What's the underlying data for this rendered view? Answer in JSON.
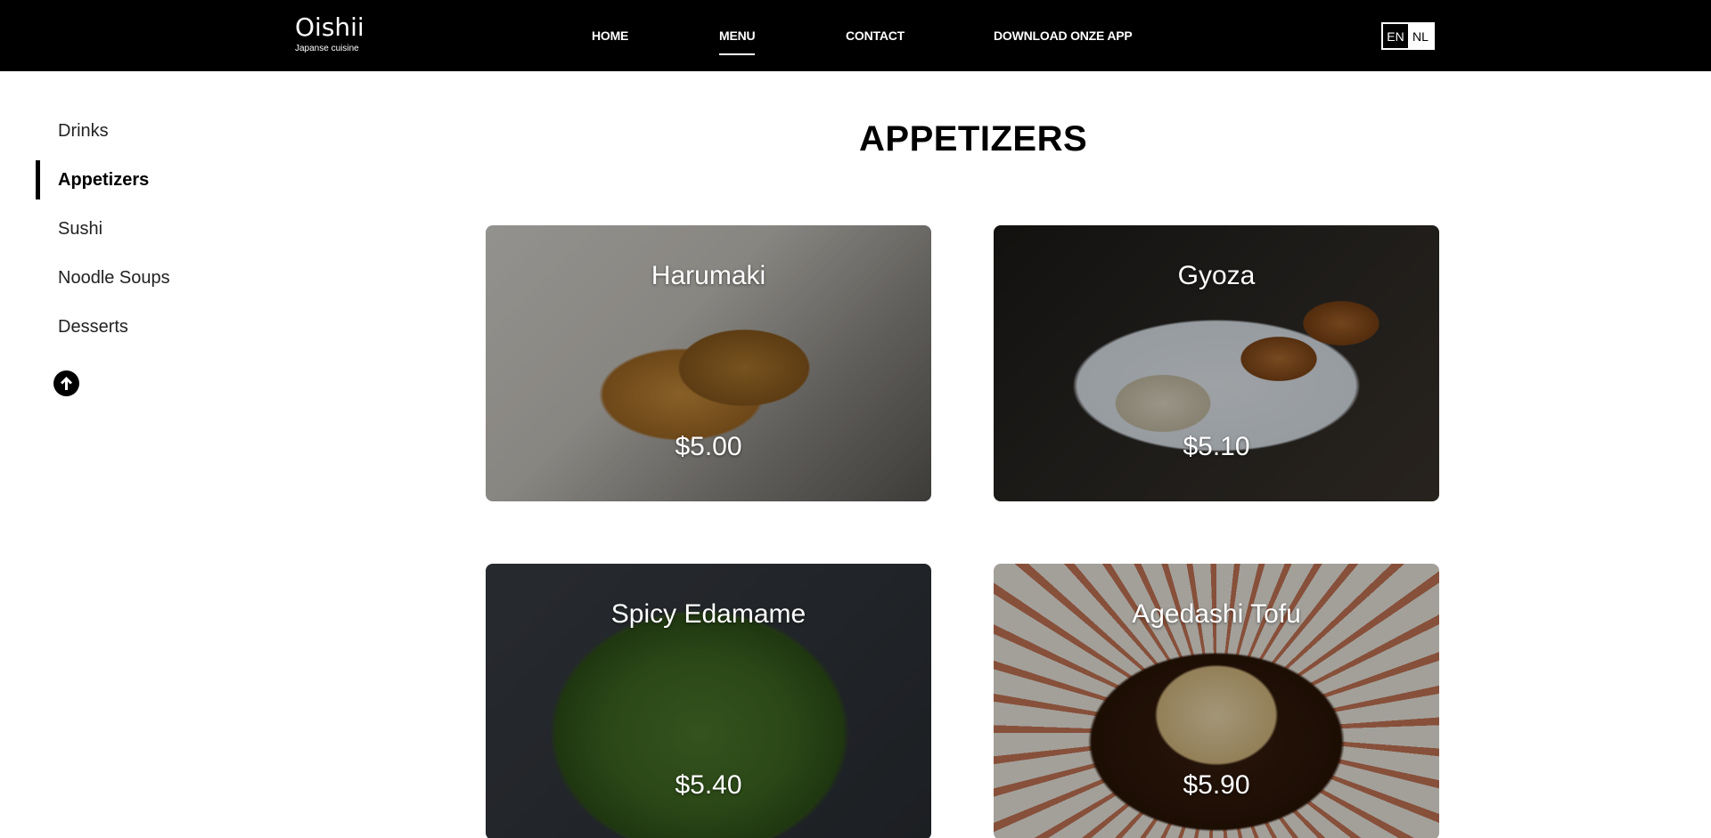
{
  "header": {
    "logo_name": "Oishii",
    "logo_tagline": "Japanse cuisine",
    "nav": [
      {
        "label": "HOME"
      },
      {
        "label": "MENU",
        "active": true
      },
      {
        "label": "CONTACT"
      },
      {
        "label": "DOWNLOAD ONZE APP"
      }
    ],
    "languages": [
      {
        "label": "EN",
        "selected": true
      },
      {
        "label": "NL"
      }
    ]
  },
  "sidebar": {
    "items": [
      {
        "label": "Drinks"
      },
      {
        "label": "Appetizers",
        "active": true
      },
      {
        "label": "Sushi"
      },
      {
        "label": "Noodle Soups"
      },
      {
        "label": "Desserts"
      }
    ],
    "scroll_top_icon": "arrow-up-circle-icon"
  },
  "main": {
    "section_title": "APPETIZERS",
    "items": [
      {
        "name": "Harumaki",
        "price": "$5.00"
      },
      {
        "name": "Gyoza",
        "price": "$5.10"
      },
      {
        "name": "Spicy Edamame",
        "price": "$5.40"
      },
      {
        "name": "Agedashi Tofu",
        "price": "$5.90"
      }
    ]
  },
  "colors": {
    "header_bg": "#000000",
    "text_on_dark": "#ffffff",
    "active_marker": "#000000"
  }
}
